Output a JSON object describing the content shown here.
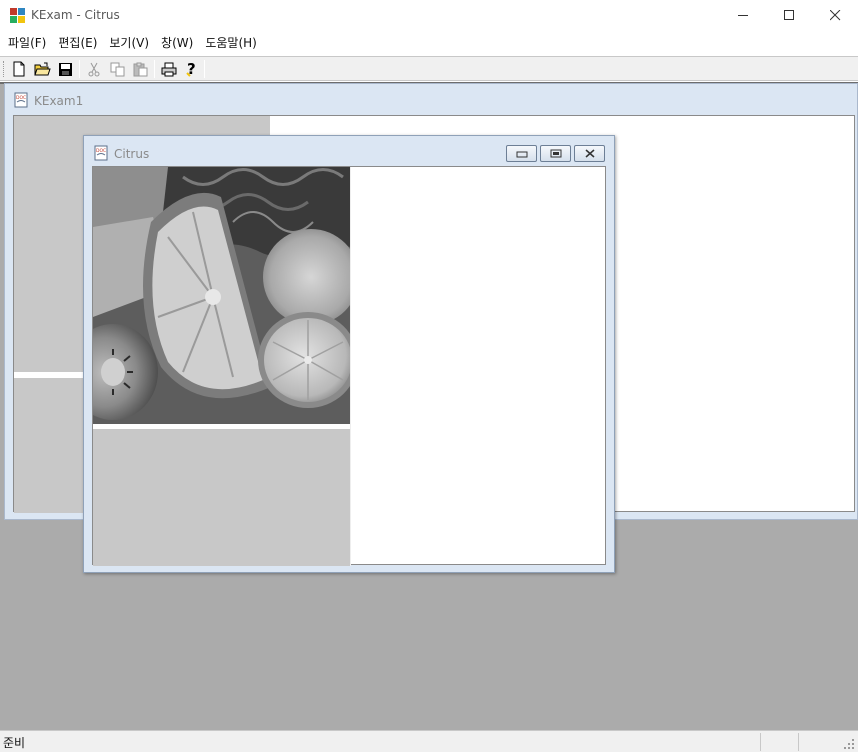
{
  "app": {
    "title": "KExam - Citrus"
  },
  "menu": {
    "items": [
      "파일(F)",
      "편집(E)",
      "보기(V)",
      "창(W)",
      "도움말(H)"
    ]
  },
  "toolbar": {
    "buttons": [
      "new-icon",
      "open-icon",
      "save-icon",
      "cut-icon",
      "copy-icon",
      "paste-icon",
      "print-icon",
      "help-icon"
    ]
  },
  "child_windows": {
    "kexam1": {
      "title": "KExam1"
    },
    "citrus": {
      "title": "Citrus"
    }
  },
  "status": {
    "text": "준비"
  },
  "colors": {
    "mdi_background": "#ababab",
    "child_frame": "#dbe6f3",
    "gray_pane": "#c8c8c8"
  }
}
